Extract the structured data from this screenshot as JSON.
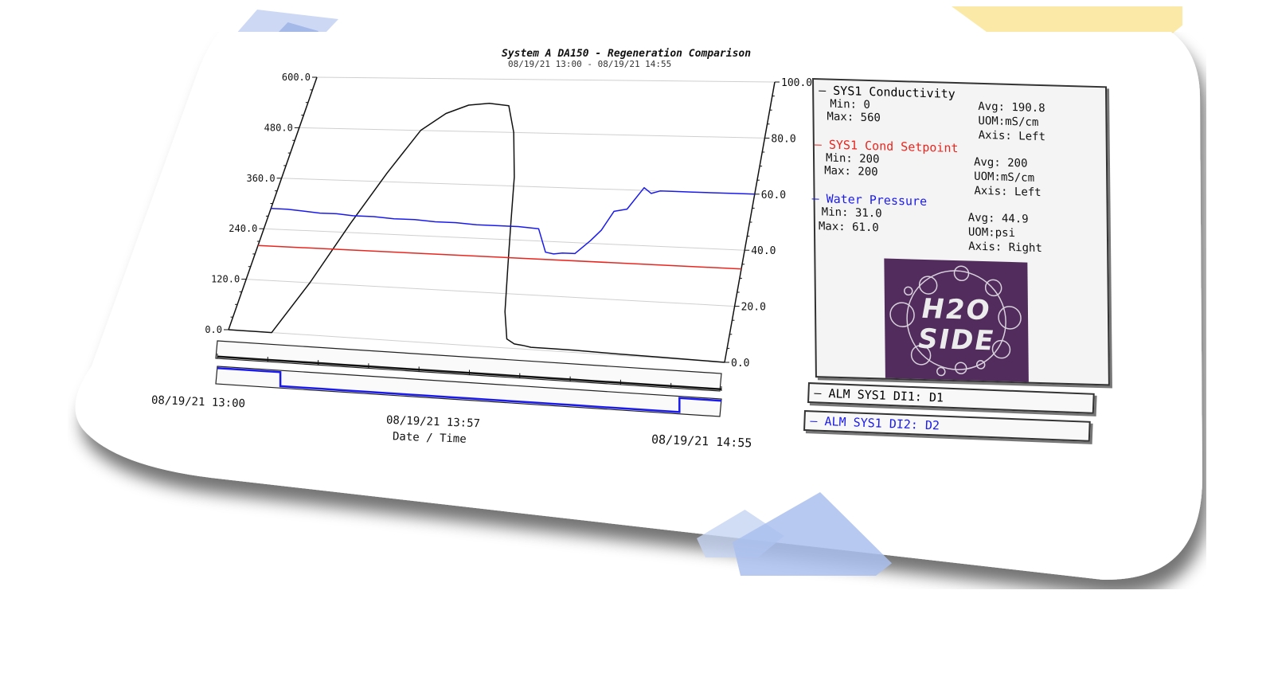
{
  "chart_data": {
    "type": "line",
    "title": "System A DA150 - Regeneration Comparison",
    "subtitle": "08/19/21 13:00 - 08/19/21 14:55",
    "xlabel": "Date / Time",
    "x_ticks": [
      "08/19/21 13:00",
      "08/19/21 13:57",
      "08/19/21 14:55"
    ],
    "y_left": {
      "ylim": [
        0,
        600
      ],
      "ticks": [
        "600.0",
        "480.0",
        "360.0",
        "240.0",
        "120.0",
        "0.0"
      ]
    },
    "y_right": {
      "ylim": [
        0,
        100
      ],
      "ticks": [
        "100.0",
        "80.0",
        "60.0",
        "40.0",
        "20.0",
        "0.0"
      ]
    },
    "grid": true,
    "x_minutes": [
      0,
      5,
      10,
      15,
      20,
      25,
      30,
      35,
      40,
      45,
      50,
      55,
      60,
      65,
      70,
      75,
      80,
      85,
      90,
      95,
      100,
      105,
      110,
      115
    ],
    "series": [
      {
        "name": "SYS1 Conductivity",
        "axis": "left",
        "color": "#111111",
        "x": [
          0,
          3,
          6,
          10,
          15,
          20,
          25,
          30,
          35,
          40,
          45,
          50,
          53,
          56,
          58,
          60,
          62,
          64,
          66,
          68,
          70,
          75,
          80,
          90,
          100,
          115
        ],
        "values": [
          0,
          0,
          0,
          0,
          120,
          260,
          380,
          480,
          520,
          540,
          545,
          540,
          480,
          380,
          280,
          180,
          80,
          20,
          10,
          8,
          5,
          5,
          5,
          3,
          2,
          0
        ]
      },
      {
        "name": "SYS1 Cond Setpoint",
        "axis": "left",
        "color": "#e8261f",
        "x": [
          0,
          115
        ],
        "values": [
          200,
          200
        ]
      },
      {
        "name": "Water Pressure",
        "axis": "right",
        "color": "#1a1aee",
        "x": [
          0,
          4,
          8,
          12,
          16,
          20,
          25,
          30,
          35,
          40,
          45,
          50,
          55,
          60,
          65,
          68,
          70,
          72,
          75,
          78,
          80,
          82,
          85,
          88,
          90,
          92,
          95,
          100,
          105,
          110,
          115
        ],
        "values": [
          48,
          48,
          47.5,
          47,
          47,
          46.5,
          46.5,
          46,
          46,
          45.5,
          45.5,
          45,
          45,
          45,
          44.5,
          36,
          35.5,
          36,
          36,
          41,
          45,
          52,
          53,
          61,
          59,
          60,
          60,
          60,
          60,
          60,
          60
        ]
      }
    ]
  },
  "legend": {
    "entries": [
      {
        "name": "SYS1 Conductivity",
        "color": "#111111",
        "min": "Min: 0",
        "max": "Max: 560",
        "avg": "Avg: 190.8",
        "uom": "UOM:mS/cm",
        "axis": "Axis: Left"
      },
      {
        "name": "SYS1 Cond Setpoint",
        "color": "#e8261f",
        "min": "Min: 200",
        "max": "Max: 200",
        "avg": "Avg: 200",
        "uom": "UOM:mS/cm",
        "axis": "Axis: Left"
      },
      {
        "name": "Water Pressure",
        "color": "#1a1aee",
        "min": "Min: 31.0",
        "max": "Max: 61.0",
        "avg": "Avg: 44.9",
        "uom": "UOM:psi",
        "axis": "Axis: Right"
      }
    ],
    "logo_line1": "H2O",
    "logo_line2": "SIDE"
  },
  "alarms": [
    {
      "label": "ALM SYS1 DI1: D1",
      "color": "#111111",
      "state": [
        0,
        0,
        0,
        0,
        0,
        0,
        0,
        0,
        0,
        0,
        0,
        0,
        0,
        0,
        0,
        0,
        0,
        0,
        0,
        0,
        0,
        0,
        0,
        0
      ]
    },
    {
      "label": "ALM SYS1 DI2: D2",
      "color": "#1a1aee",
      "state": [
        1,
        1,
        1,
        0,
        0,
        0,
        0,
        0,
        0,
        0,
        0,
        0,
        0,
        0,
        0,
        0,
        0,
        0,
        0,
        0,
        0,
        0,
        1,
        1
      ]
    }
  ],
  "colors": {
    "background": "#ffffff",
    "panel": "#f4f4f4",
    "logo_bg": "#512c5c",
    "grid": "#cccccc"
  }
}
